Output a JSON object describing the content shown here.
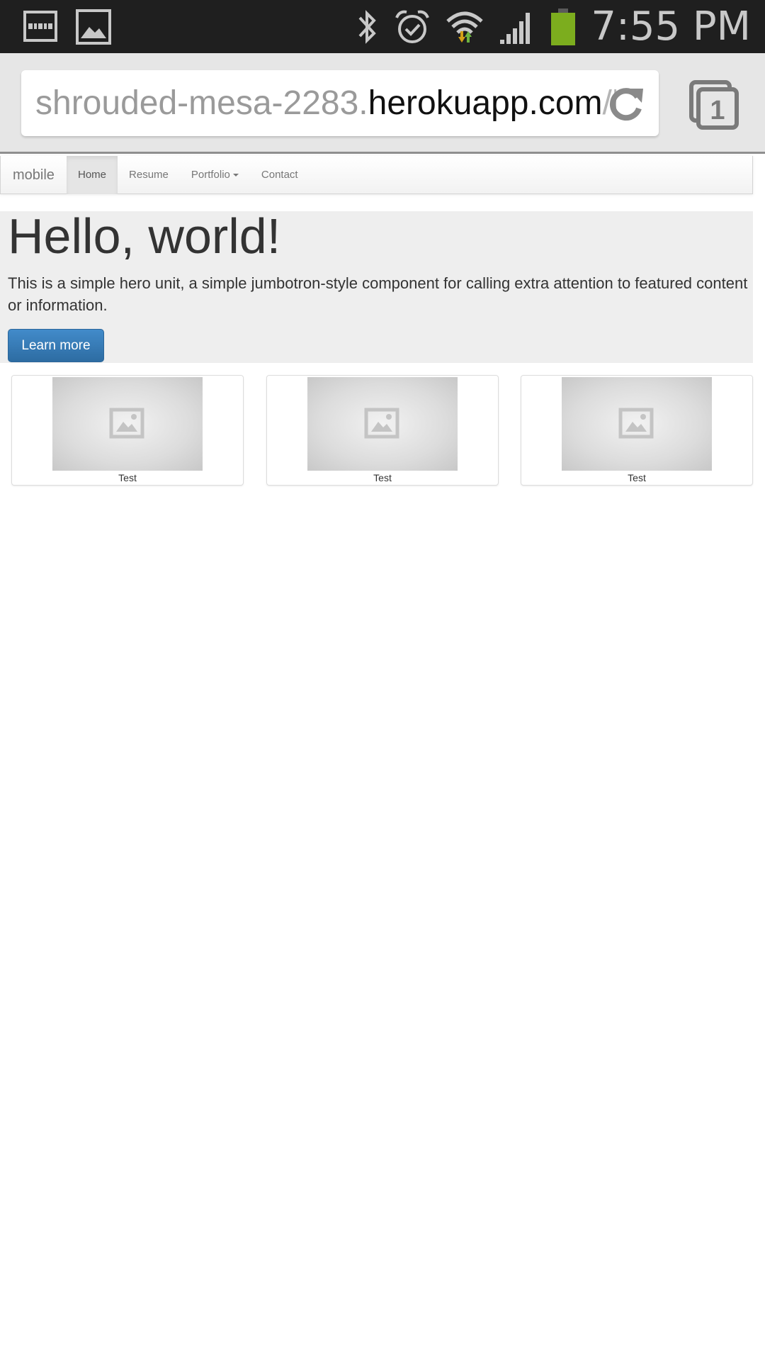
{
  "status_bar": {
    "time": "7:55 PM",
    "left_icons": [
      "screen-mirror-icon",
      "gallery-icon"
    ],
    "right_icons": [
      "bluetooth-icon",
      "alarm-icon",
      "wifi-icon",
      "signal-icon",
      "battery-icon"
    ]
  },
  "browser": {
    "url_subdomain": "shrouded-mesa-2283.",
    "url_domain": "herokuapp.com",
    "url_path": "/h",
    "tab_count": "1"
  },
  "navbar": {
    "brand": "mobile",
    "items": [
      {
        "label": "Home",
        "active": true
      },
      {
        "label": "Resume",
        "active": false
      },
      {
        "label": "Portfolio",
        "active": false,
        "dropdown": true
      },
      {
        "label": "Contact",
        "active": false
      }
    ]
  },
  "hero": {
    "title": "Hello, world!",
    "text": "This is a simple hero unit, a simple jumbotron-style component for calling extra attention to featured content or information.",
    "button": "Learn more"
  },
  "thumbnails": [
    {
      "caption": "Test"
    },
    {
      "caption": "Test"
    },
    {
      "caption": "Test"
    }
  ],
  "colors": {
    "primary_button": "#428bca",
    "battery": "#7cad1e",
    "hero_bg": "#eeeeee"
  }
}
